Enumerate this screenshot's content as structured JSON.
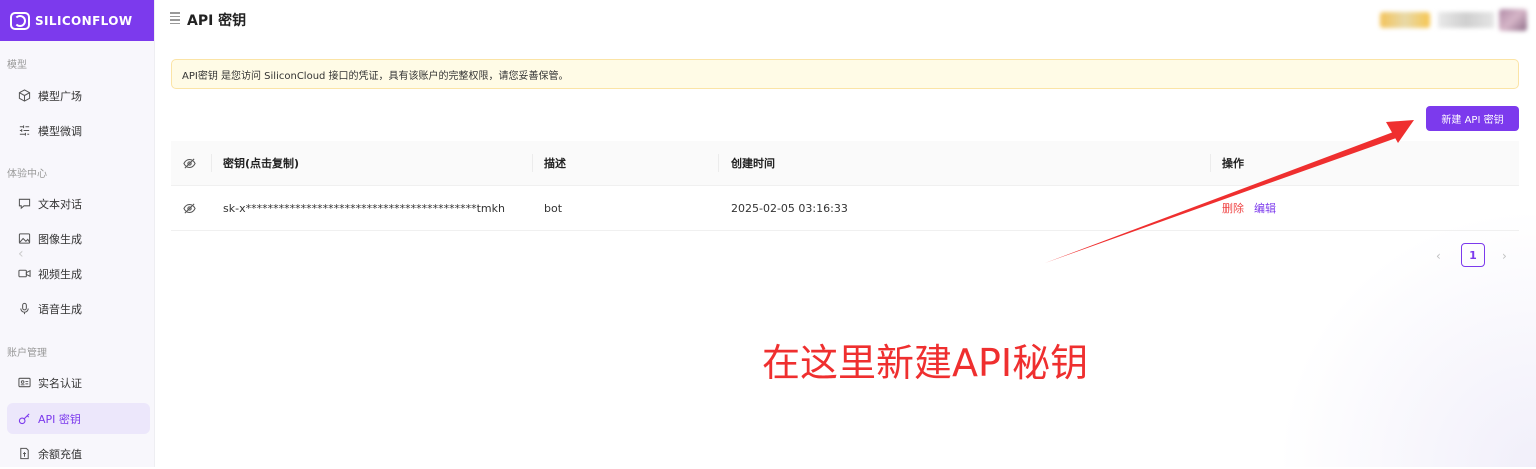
{
  "app": {
    "logo_text": "SILICONFLOW"
  },
  "sidebar": {
    "sections": [
      {
        "label": "模型"
      },
      {
        "label": "体验中心"
      },
      {
        "label": "账户管理"
      }
    ],
    "items": [
      {
        "label": "模型广场",
        "icon": "cube-icon"
      },
      {
        "label": "模型微调",
        "icon": "tune-icon"
      },
      {
        "label": "文本对话",
        "icon": "chat-icon"
      },
      {
        "label": "图像生成",
        "icon": "image-icon"
      },
      {
        "label": "视频生成",
        "icon": "video-icon"
      },
      {
        "label": "语音生成",
        "icon": "mic-icon"
      },
      {
        "label": "实名认证",
        "icon": "id-card-icon"
      },
      {
        "label": "API 密钥",
        "icon": "key-icon",
        "active": true
      },
      {
        "label": "余额充值",
        "icon": "recharge-icon"
      }
    ]
  },
  "header": {
    "title": "API 密钥"
  },
  "notice": {
    "text": "API密钥 是您访问 SiliconCloud 接口的凭证，具有该账户的完整权限，请您妥善保管。"
  },
  "toolbar": {
    "new_key_label": "新建 API 密钥"
  },
  "table": {
    "columns": [
      "密钥(点击复制)",
      "描述",
      "创建时间",
      "操作"
    ],
    "rows": [
      {
        "key": "sk-x******************************************tmkh",
        "description": "bot",
        "created": "2025-02-05 03:16:33",
        "delete_label": "删除",
        "edit_label": "编辑"
      }
    ]
  },
  "pagination": {
    "current": "1"
  },
  "annotation": {
    "text": "在这里新建API秘钥",
    "color": "#ef2f2f"
  },
  "colors": {
    "accent": "#7c3aed",
    "danger": "#ef4444",
    "notice_bg": "#fffbe6"
  }
}
